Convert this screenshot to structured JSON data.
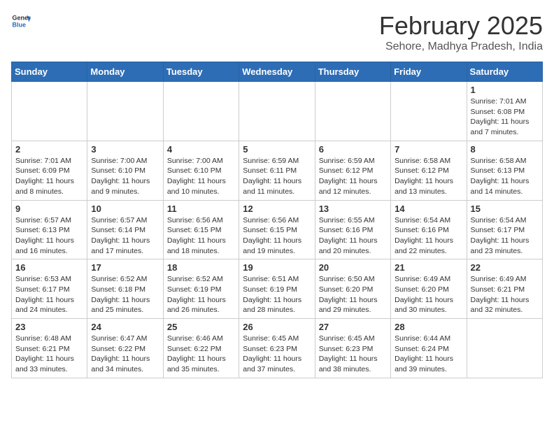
{
  "header": {
    "logo_general": "General",
    "logo_blue": "Blue",
    "month_title": "February 2025",
    "location": "Sehore, Madhya Pradesh, India"
  },
  "days_of_week": [
    "Sunday",
    "Monday",
    "Tuesday",
    "Wednesday",
    "Thursday",
    "Friday",
    "Saturday"
  ],
  "weeks": [
    [
      {
        "day": null
      },
      {
        "day": null
      },
      {
        "day": null
      },
      {
        "day": null
      },
      {
        "day": null
      },
      {
        "day": null
      },
      {
        "day": 1,
        "sunrise": "7:01 AM",
        "sunset": "6:08 PM",
        "daylight": "11 hours and 7 minutes."
      }
    ],
    [
      {
        "day": 2,
        "sunrise": "7:01 AM",
        "sunset": "6:09 PM",
        "daylight": "11 hours and 8 minutes."
      },
      {
        "day": 3,
        "sunrise": "7:00 AM",
        "sunset": "6:10 PM",
        "daylight": "11 hours and 9 minutes."
      },
      {
        "day": 4,
        "sunrise": "7:00 AM",
        "sunset": "6:10 PM",
        "daylight": "11 hours and 10 minutes."
      },
      {
        "day": 5,
        "sunrise": "6:59 AM",
        "sunset": "6:11 PM",
        "daylight": "11 hours and 11 minutes."
      },
      {
        "day": 6,
        "sunrise": "6:59 AM",
        "sunset": "6:12 PM",
        "daylight": "11 hours and 12 minutes."
      },
      {
        "day": 7,
        "sunrise": "6:58 AM",
        "sunset": "6:12 PM",
        "daylight": "11 hours and 13 minutes."
      },
      {
        "day": 8,
        "sunrise": "6:58 AM",
        "sunset": "6:13 PM",
        "daylight": "11 hours and 14 minutes."
      }
    ],
    [
      {
        "day": 9,
        "sunrise": "6:57 AM",
        "sunset": "6:13 PM",
        "daylight": "11 hours and 16 minutes."
      },
      {
        "day": 10,
        "sunrise": "6:57 AM",
        "sunset": "6:14 PM",
        "daylight": "11 hours and 17 minutes."
      },
      {
        "day": 11,
        "sunrise": "6:56 AM",
        "sunset": "6:15 PM",
        "daylight": "11 hours and 18 minutes."
      },
      {
        "day": 12,
        "sunrise": "6:56 AM",
        "sunset": "6:15 PM",
        "daylight": "11 hours and 19 minutes."
      },
      {
        "day": 13,
        "sunrise": "6:55 AM",
        "sunset": "6:16 PM",
        "daylight": "11 hours and 20 minutes."
      },
      {
        "day": 14,
        "sunrise": "6:54 AM",
        "sunset": "6:16 PM",
        "daylight": "11 hours and 22 minutes."
      },
      {
        "day": 15,
        "sunrise": "6:54 AM",
        "sunset": "6:17 PM",
        "daylight": "11 hours and 23 minutes."
      }
    ],
    [
      {
        "day": 16,
        "sunrise": "6:53 AM",
        "sunset": "6:17 PM",
        "daylight": "11 hours and 24 minutes."
      },
      {
        "day": 17,
        "sunrise": "6:52 AM",
        "sunset": "6:18 PM",
        "daylight": "11 hours and 25 minutes."
      },
      {
        "day": 18,
        "sunrise": "6:52 AM",
        "sunset": "6:19 PM",
        "daylight": "11 hours and 26 minutes."
      },
      {
        "day": 19,
        "sunrise": "6:51 AM",
        "sunset": "6:19 PM",
        "daylight": "11 hours and 28 minutes."
      },
      {
        "day": 20,
        "sunrise": "6:50 AM",
        "sunset": "6:20 PM",
        "daylight": "11 hours and 29 minutes."
      },
      {
        "day": 21,
        "sunrise": "6:49 AM",
        "sunset": "6:20 PM",
        "daylight": "11 hours and 30 minutes."
      },
      {
        "day": 22,
        "sunrise": "6:49 AM",
        "sunset": "6:21 PM",
        "daylight": "11 hours and 32 minutes."
      }
    ],
    [
      {
        "day": 23,
        "sunrise": "6:48 AM",
        "sunset": "6:21 PM",
        "daylight": "11 hours and 33 minutes."
      },
      {
        "day": 24,
        "sunrise": "6:47 AM",
        "sunset": "6:22 PM",
        "daylight": "11 hours and 34 minutes."
      },
      {
        "day": 25,
        "sunrise": "6:46 AM",
        "sunset": "6:22 PM",
        "daylight": "11 hours and 35 minutes."
      },
      {
        "day": 26,
        "sunrise": "6:45 AM",
        "sunset": "6:23 PM",
        "daylight": "11 hours and 37 minutes."
      },
      {
        "day": 27,
        "sunrise": "6:45 AM",
        "sunset": "6:23 PM",
        "daylight": "11 hours and 38 minutes."
      },
      {
        "day": 28,
        "sunrise": "6:44 AM",
        "sunset": "6:24 PM",
        "daylight": "11 hours and 39 minutes."
      },
      {
        "day": null
      }
    ]
  ]
}
